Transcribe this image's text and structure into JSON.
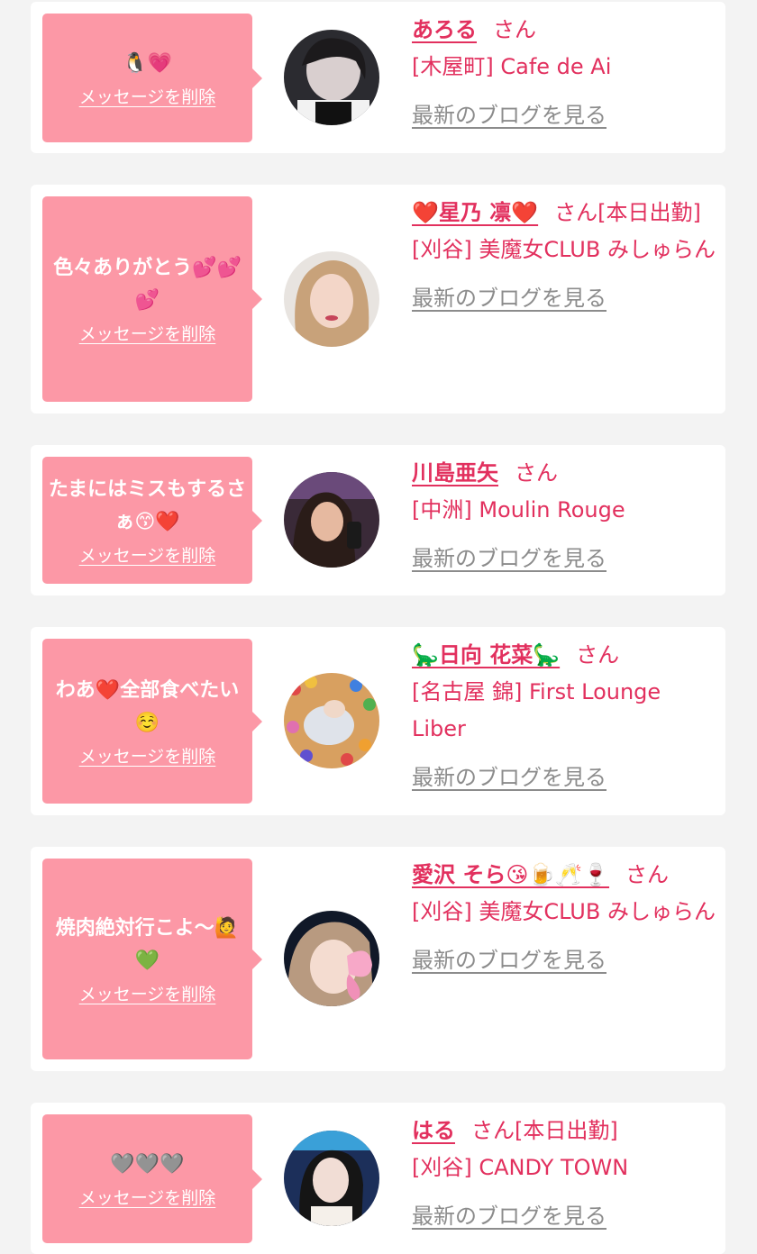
{
  "delete_label": "メッセージを削除",
  "blog_label": "最新のブログを見る",
  "honorific": "さん",
  "colors": {
    "page_background": "#f3f3f3",
    "card_background": "#ffffff",
    "bubble": "#fc98a6",
    "accent_text": "#e2305e",
    "muted_link": "#8c8c8c"
  },
  "entries": [
    {
      "message": "🐧💗",
      "name": "あろる",
      "status": "",
      "shop": "[木屋町] Cafe de Ai",
      "avatar": "avatar-photo-dark-hair-maid"
    },
    {
      "message": "色々ありがとう💕💕💕",
      "name": "❤️星乃 凛❤️",
      "status": "[本日出勤]",
      "shop": "[刈谷] 美魔女CLUB みしゅらん",
      "avatar": "avatar-photo-blonde-woman"
    },
    {
      "message": "たまにはミスもするさぁ😙❤️",
      "name": "川島亜矢",
      "status": "",
      "shop": "[中洲] Moulin Rouge",
      "avatar": "avatar-photo-woman-club"
    },
    {
      "message": "わあ❤️全部食べたい☺️",
      "name": "🦕日向 花菜🦕",
      "status": "",
      "shop": "[名古屋 錦] First Lounge Liber",
      "avatar": "avatar-photo-ball-pit"
    },
    {
      "message": "焼肉絶対行こよ〜🙋💚",
      "name": "愛沢 そら😘🍺🥂🍷",
      "status": "",
      "shop": "[刈谷] 美魔女CLUB みしゅらん",
      "avatar": "avatar-photo-butterfly"
    },
    {
      "message": "🩶🩶🩶",
      "name": "はる",
      "status": "[本日出勤]",
      "shop": "[刈谷] CANDY TOWN",
      "avatar": "avatar-photo-woman-neon"
    }
  ]
}
